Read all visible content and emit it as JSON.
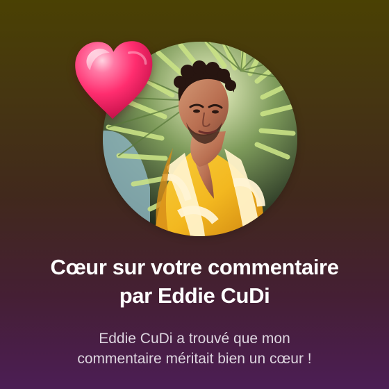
{
  "notification": {
    "title": [
      "Cœur sur votre commentaire",
      "par Eddie CuDi"
    ],
    "description": [
      "Eddie CuDi a trouvé que mon",
      "commentaire méritait bien un cœur !"
    ],
    "icons": {
      "heart": "heart-icon"
    },
    "colors": {
      "background_top": "#4a4103",
      "background_bottom": "#4c1e55",
      "heart": "#ff2d6f",
      "title": "#ffffff",
      "description": "#ddd5df"
    }
  }
}
